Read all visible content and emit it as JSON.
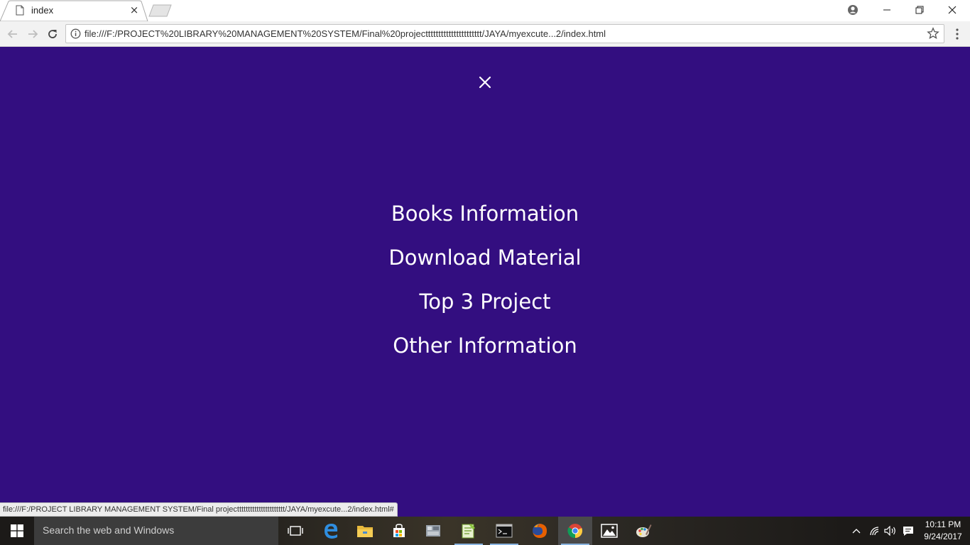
{
  "browser": {
    "tab_title": "index",
    "tab_close": "×",
    "url": "file:///F:/PROJECT%20LIBRARY%20MANAGEMENT%20SYSTEM/Final%20projectttttttttttttttttttttt/JAYA/myexcute...2/index.html",
    "status_url": "file:///F:/PROJECT LIBRARY MANAGEMENT SYSTEM/Final projectttttttttttttttttttttt/JAYA/myexcute...2/index.html#"
  },
  "overlay_menu": {
    "items": [
      {
        "label": "Books Information"
      },
      {
        "label": "Download Material"
      },
      {
        "label": "Top 3 Project"
      },
      {
        "label": "Other Information"
      }
    ],
    "background_color": "#330e80",
    "text_color": "#ffffff"
  },
  "taskbar": {
    "search_placeholder": "Search the web and Windows",
    "time": "10:11 PM",
    "date": "9/24/2017"
  }
}
